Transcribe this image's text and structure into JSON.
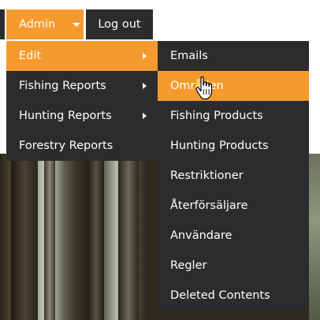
{
  "topbar": {
    "admin_label": "Admin",
    "logout_label": "Log out"
  },
  "menu": {
    "items": [
      {
        "label": "Edit",
        "has_submenu": true,
        "active": true
      },
      {
        "label": "Fishing Reports",
        "has_submenu": true,
        "active": false
      },
      {
        "label": "Hunting Reports",
        "has_submenu": true,
        "active": false
      },
      {
        "label": "Forestry Reports",
        "has_submenu": false,
        "active": false
      }
    ]
  },
  "submenu": {
    "items": [
      {
        "label": "Emails",
        "active": false
      },
      {
        "label": "Områden",
        "active": true
      },
      {
        "label": "Fishing Products",
        "active": false
      },
      {
        "label": "Hunting Products",
        "active": false
      },
      {
        "label": "Restriktioner",
        "active": false
      },
      {
        "label": "Återförsäljare",
        "active": false
      },
      {
        "label": "Användare",
        "active": false
      },
      {
        "label": "Regler",
        "active": false
      },
      {
        "label": "Deleted Contents",
        "active": false
      }
    ]
  },
  "icons": {
    "admin_caret": "caret-down-icon",
    "submenu_arrow": "chevron-right-icon",
    "cursor": "hand-pointer-icon"
  },
  "colors": {
    "accent": "#f59a2e",
    "menu_bg": "#2c2c2c",
    "text": "#ffffff"
  }
}
